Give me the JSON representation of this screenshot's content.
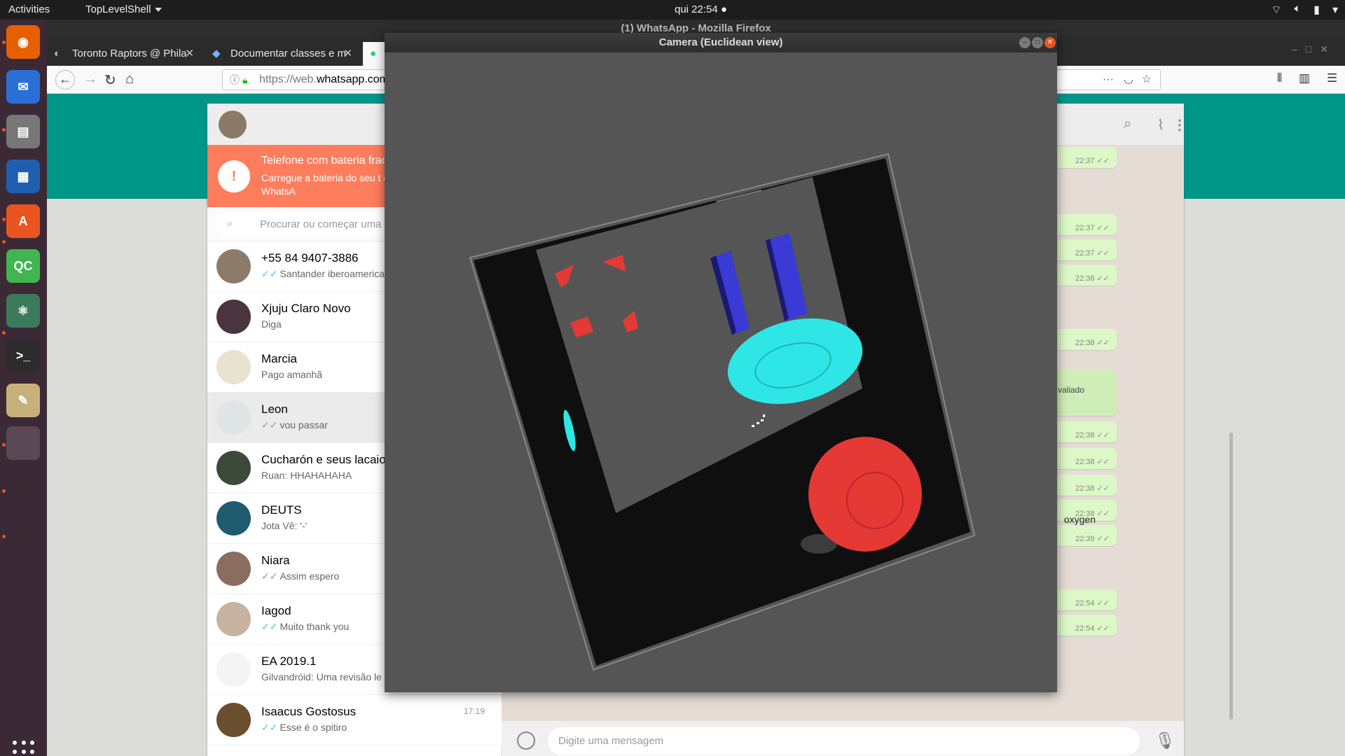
{
  "topbar": {
    "activities": "Activities",
    "app_menu": "TopLevelShell",
    "clock": "qui 22:54 ●"
  },
  "dock": {
    "apps": [
      {
        "name": "firefox",
        "color": "#e66000",
        "glyph": "◉"
      },
      {
        "name": "thunderbird",
        "color": "#2a6fd6",
        "glyph": "✉"
      },
      {
        "name": "files",
        "color": "#777777",
        "glyph": "▤"
      },
      {
        "name": "writer",
        "color": "#1f5fb0",
        "glyph": "▦"
      },
      {
        "name": "software",
        "color": "#e95420",
        "glyph": "A"
      },
      {
        "name": "qtcreator",
        "color": "#41b650",
        "glyph": "QC"
      },
      {
        "name": "atom",
        "color": "#3b7a5a",
        "glyph": "⚛"
      },
      {
        "name": "terminal",
        "color": "#2c2c2c",
        "glyph": ">_"
      },
      {
        "name": "text-editor",
        "color": "#c8b07a",
        "glyph": "✎"
      },
      {
        "name": "active-app",
        "color": "#5b4855",
        "glyph": ""
      }
    ]
  },
  "firefox": {
    "window_title": "(1) WhatsApp - Mozilla Firefox",
    "tabs": [
      {
        "label": "Toronto Raptors @ Phila"
      },
      {
        "label": "Documentar classes e m"
      }
    ],
    "url_prefix": "https://web.",
    "url_domain": "whatsapp.com"
  },
  "whatsapp": {
    "battery_title": "Telefone com bateria frac",
    "battery_sub": "Carregue a bateria do seu t continuar usando o WhatsA",
    "search_placeholder": "Procurar ou começar uma n",
    "chats": [
      {
        "name": "+55 84 9407-3886",
        "msg": "Santander iberoamerican",
        "tick": "blue",
        "time": "",
        "avatar": "#8d7b69"
      },
      {
        "name": "Xjuju Claro Novo",
        "msg": "Diga",
        "tick": "",
        "time": "",
        "avatar": "#4a3440"
      },
      {
        "name": "Marcia",
        "msg": "Pago amanhã",
        "tick": "",
        "time": "",
        "avatar": "#e8e2cf"
      },
      {
        "name": "Leon",
        "msg": "vou passar",
        "tick": "grey",
        "time": "",
        "avatar": "#dfe5e7",
        "active": true
      },
      {
        "name": "Cucharón e seus lacaio",
        "msg": "Ruan: HHAHAHAHA",
        "tick": "",
        "time": "",
        "avatar": "#3d4a3a"
      },
      {
        "name": "DEUTS",
        "msg": "Jota Vê: '-'",
        "tick": "",
        "time": "",
        "avatar": "#1e5b6e"
      },
      {
        "name": "Niara",
        "msg": "Assim espero",
        "tick": "grey",
        "time": "",
        "avatar": "#8a6d5e"
      },
      {
        "name": "Iagod",
        "msg": "Muito thank you",
        "tick": "blue",
        "time": "",
        "avatar": "#c7b3a0"
      },
      {
        "name": "EA 2019.1",
        "msg": "Gilvandróid: Uma revisão le",
        "tick": "",
        "time": "",
        "avatar": "#f4f4f4"
      },
      {
        "name": "Isaacus Gostosus",
        "msg": "Esse é o spitiro",
        "tick": "blue",
        "time": "17:19",
        "avatar": "#6b4e2e"
      }
    ],
    "bubbles": [
      {
        "time": "22:37 ✓✓"
      },
      {
        "time": "22:37 ✓✓"
      },
      {
        "time": "22:37 ✓✓"
      },
      {
        "time": "22:38 ✓✓"
      },
      {
        "time": "22:38 ✓✓"
      },
      {
        "time": "22:38 ✓✓"
      },
      {
        "time": "22:38 ✓✓"
      },
      {
        "time": "22:38 ✓✓"
      },
      {
        "time": "22:38 ✓✓"
      },
      {
        "time": "22:39 ✓✓"
      },
      {
        "time": "22:54 ✓✓"
      },
      {
        "time": "22:54 ✓✓"
      }
    ],
    "bubble_text_avaliado": "valiado",
    "bubble_text_oxygen": "oxygen",
    "message_placeholder": "Digite uma mensagem"
  },
  "camera": {
    "title": "Camera (Euclidean view)"
  }
}
